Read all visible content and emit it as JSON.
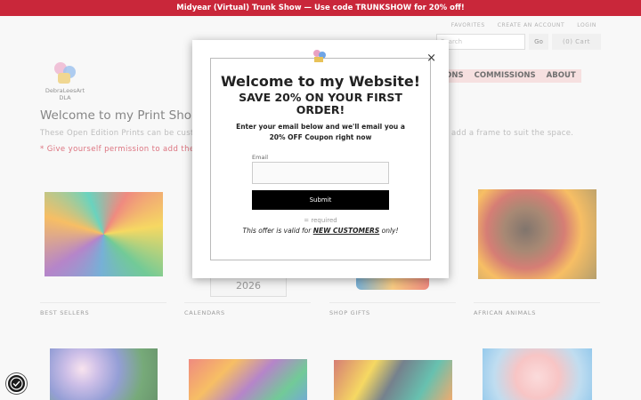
{
  "promo": {
    "text": "Midyear (Virtual) Trunk Show — Use code TRUNKSHOW for 20% off!"
  },
  "header": {
    "links": [
      "FAVORITES",
      "CREATE AN ACCOUNT",
      "LOGIN"
    ],
    "search_placeholder": "Search",
    "go_label": "Go",
    "cart_label": "(0)  Cart",
    "logo_name": "DebraLeesArt",
    "logo_sub": "DLA"
  },
  "nav": {
    "items": [
      "IONS",
      "COMMISSIONS",
      "ABOUT"
    ]
  },
  "page": {
    "heading": "Welcome to my Print Shop",
    "desc_left": "These Open Edition Prints can be cust",
    "desc_right": "add a frame to suit the space.",
    "note": "* Give yourself permission to add the"
  },
  "tiles": {
    "row1": [
      "BEST SELLERS",
      "CALENDARS",
      "SHOP GIFTS",
      "AFRICAN ANIMALS"
    ],
    "calendar_year": "2026"
  },
  "modal": {
    "title": "Welcome to my Website!",
    "subtitle": "SAVE 20% ON YOUR FIRST ORDER!",
    "body": "Enter your email below and we'll email you a 20% OFF Coupon right now",
    "email_label": "Email",
    "submit_label": "Submit",
    "required_note": "= required",
    "offer_prefix": "This offer is valid for ",
    "offer_emph": "NEW CUSTOMERS",
    "offer_suffix": " only!",
    "close_label": "×"
  }
}
